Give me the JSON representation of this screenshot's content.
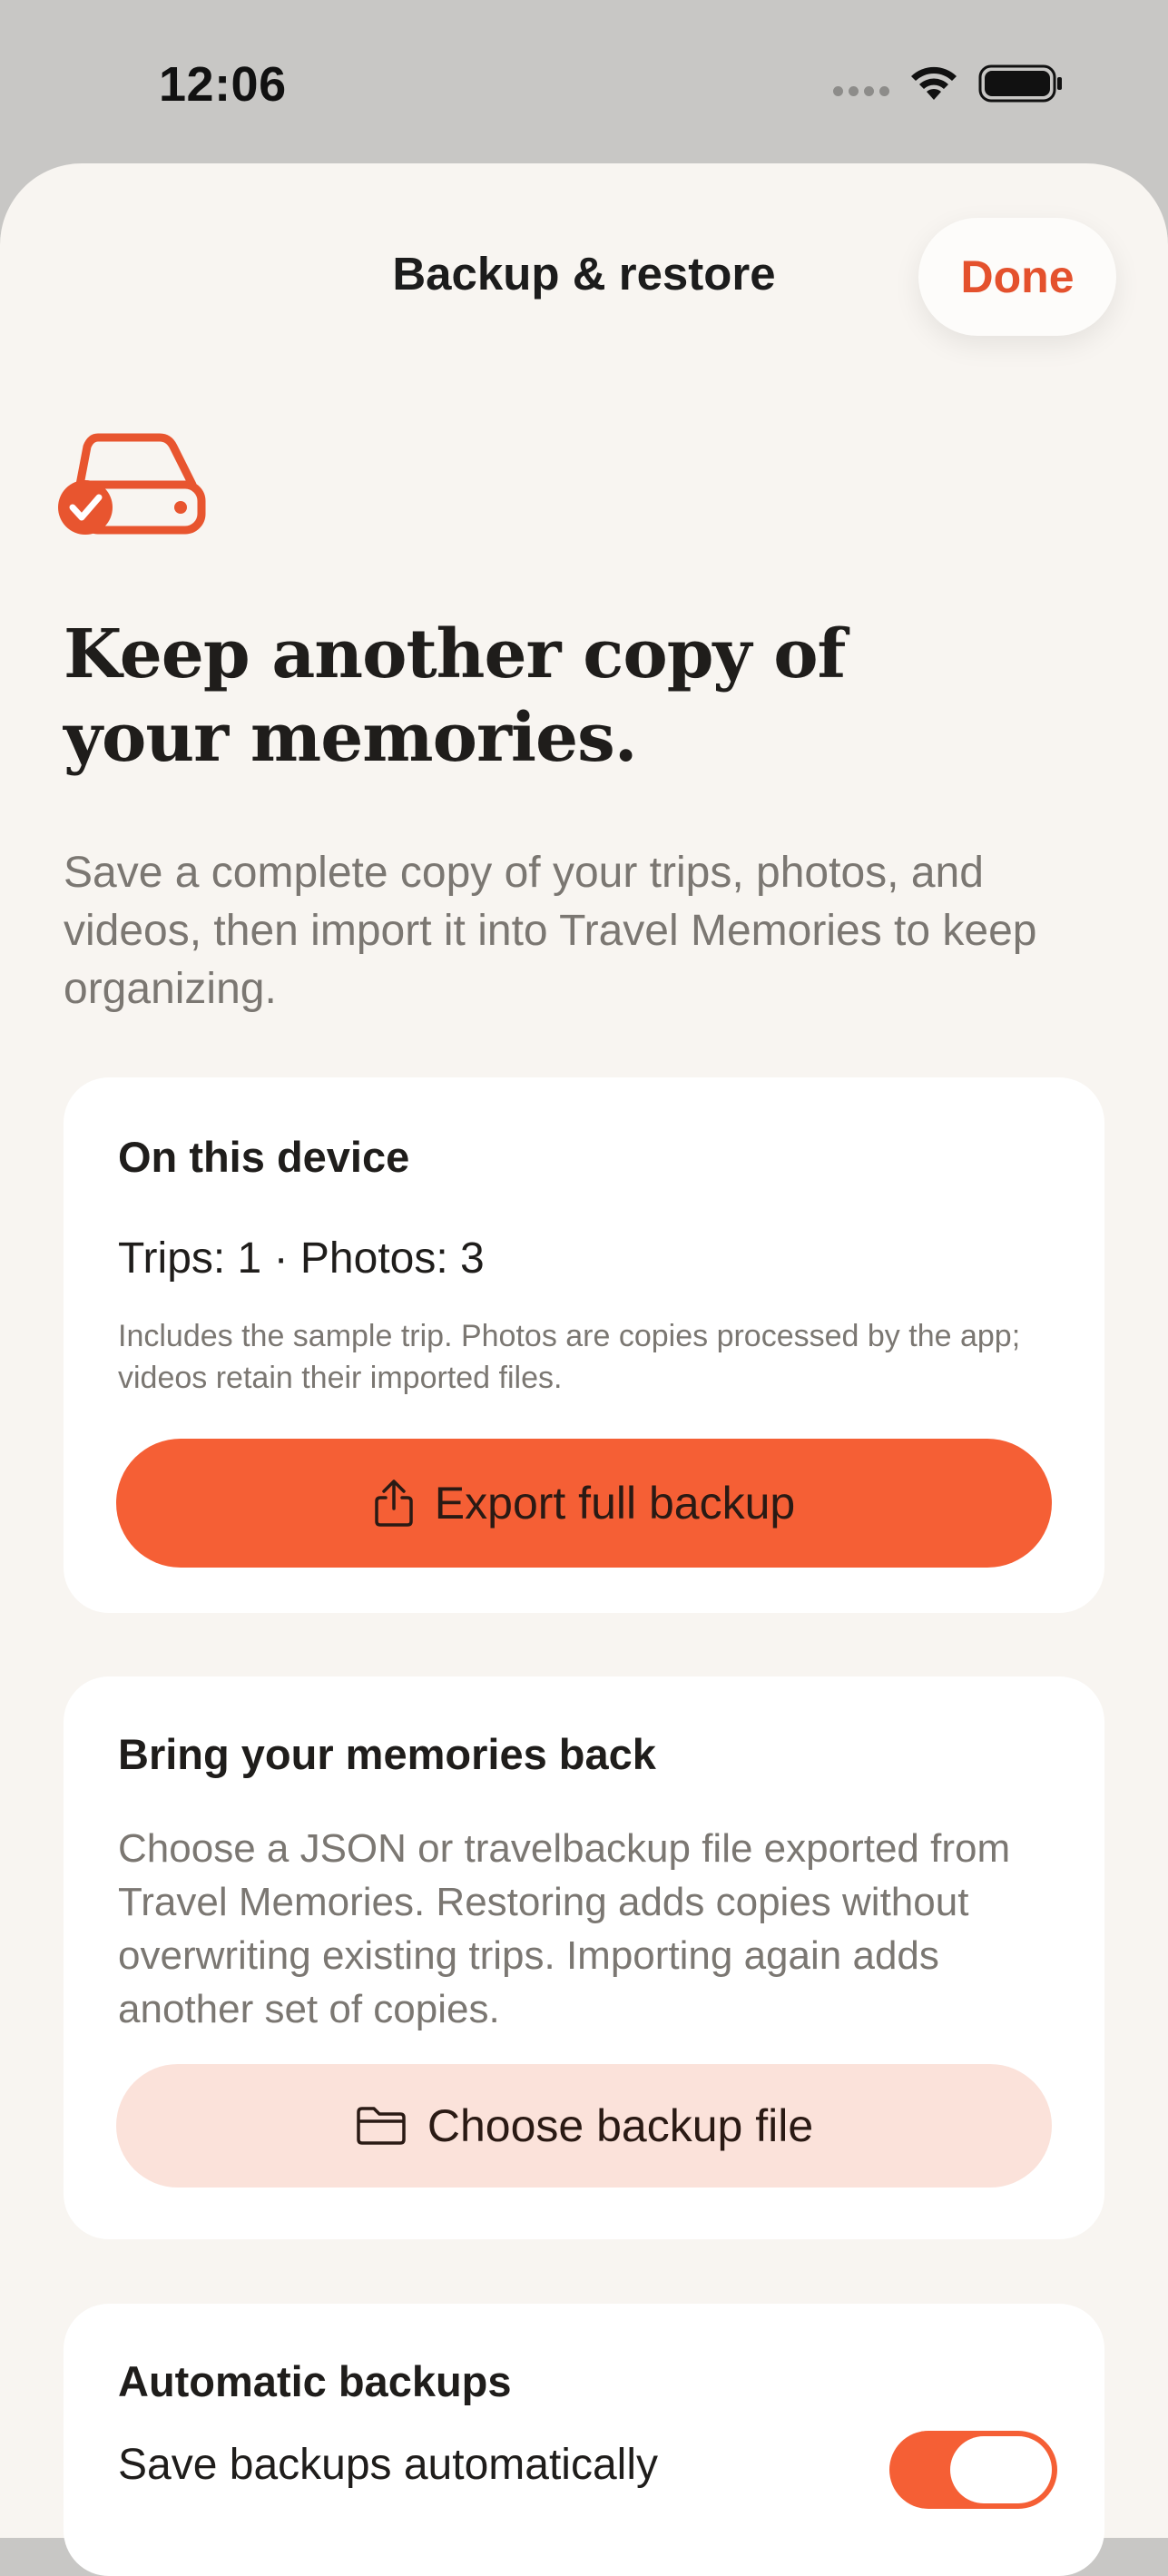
{
  "status_bar": {
    "time": "12:06"
  },
  "nav": {
    "title": "Backup & restore",
    "done_label": "Done"
  },
  "hero": {
    "icon": "drive-check-icon",
    "headline_line1": "Keep another copy of",
    "headline_line2": "your memories.",
    "intro": "Save a complete copy of your trips, photos, and videos, then import it into Travel Memories to keep organizing."
  },
  "device_card": {
    "title": "On this device",
    "counts": "Trips: 1 · Photos: 3",
    "note": "Includes the sample trip. Photos are copies processed by the app; videos retain their imported files.",
    "export_label": "Export full backup",
    "export_icon": "share-icon"
  },
  "restore_card": {
    "title": "Bring your memories back",
    "description": "Choose a JSON or travelbackup file exported from Travel Memories. Restoring adds copies without overwriting existing trips. Importing again adds another set of copies.",
    "choose_label": "Choose backup file",
    "choose_icon": "folder-icon"
  },
  "auto_card": {
    "title": "Automatic backups",
    "toggle_label": "Save backups automatically",
    "toggle_on": true
  },
  "colors": {
    "accent": "#f55f35",
    "accent_text": "#e4512d",
    "accent_soft": "#fbe2da",
    "sheet_bg": "#f8f5f1",
    "muted_text": "#7b7772"
  }
}
